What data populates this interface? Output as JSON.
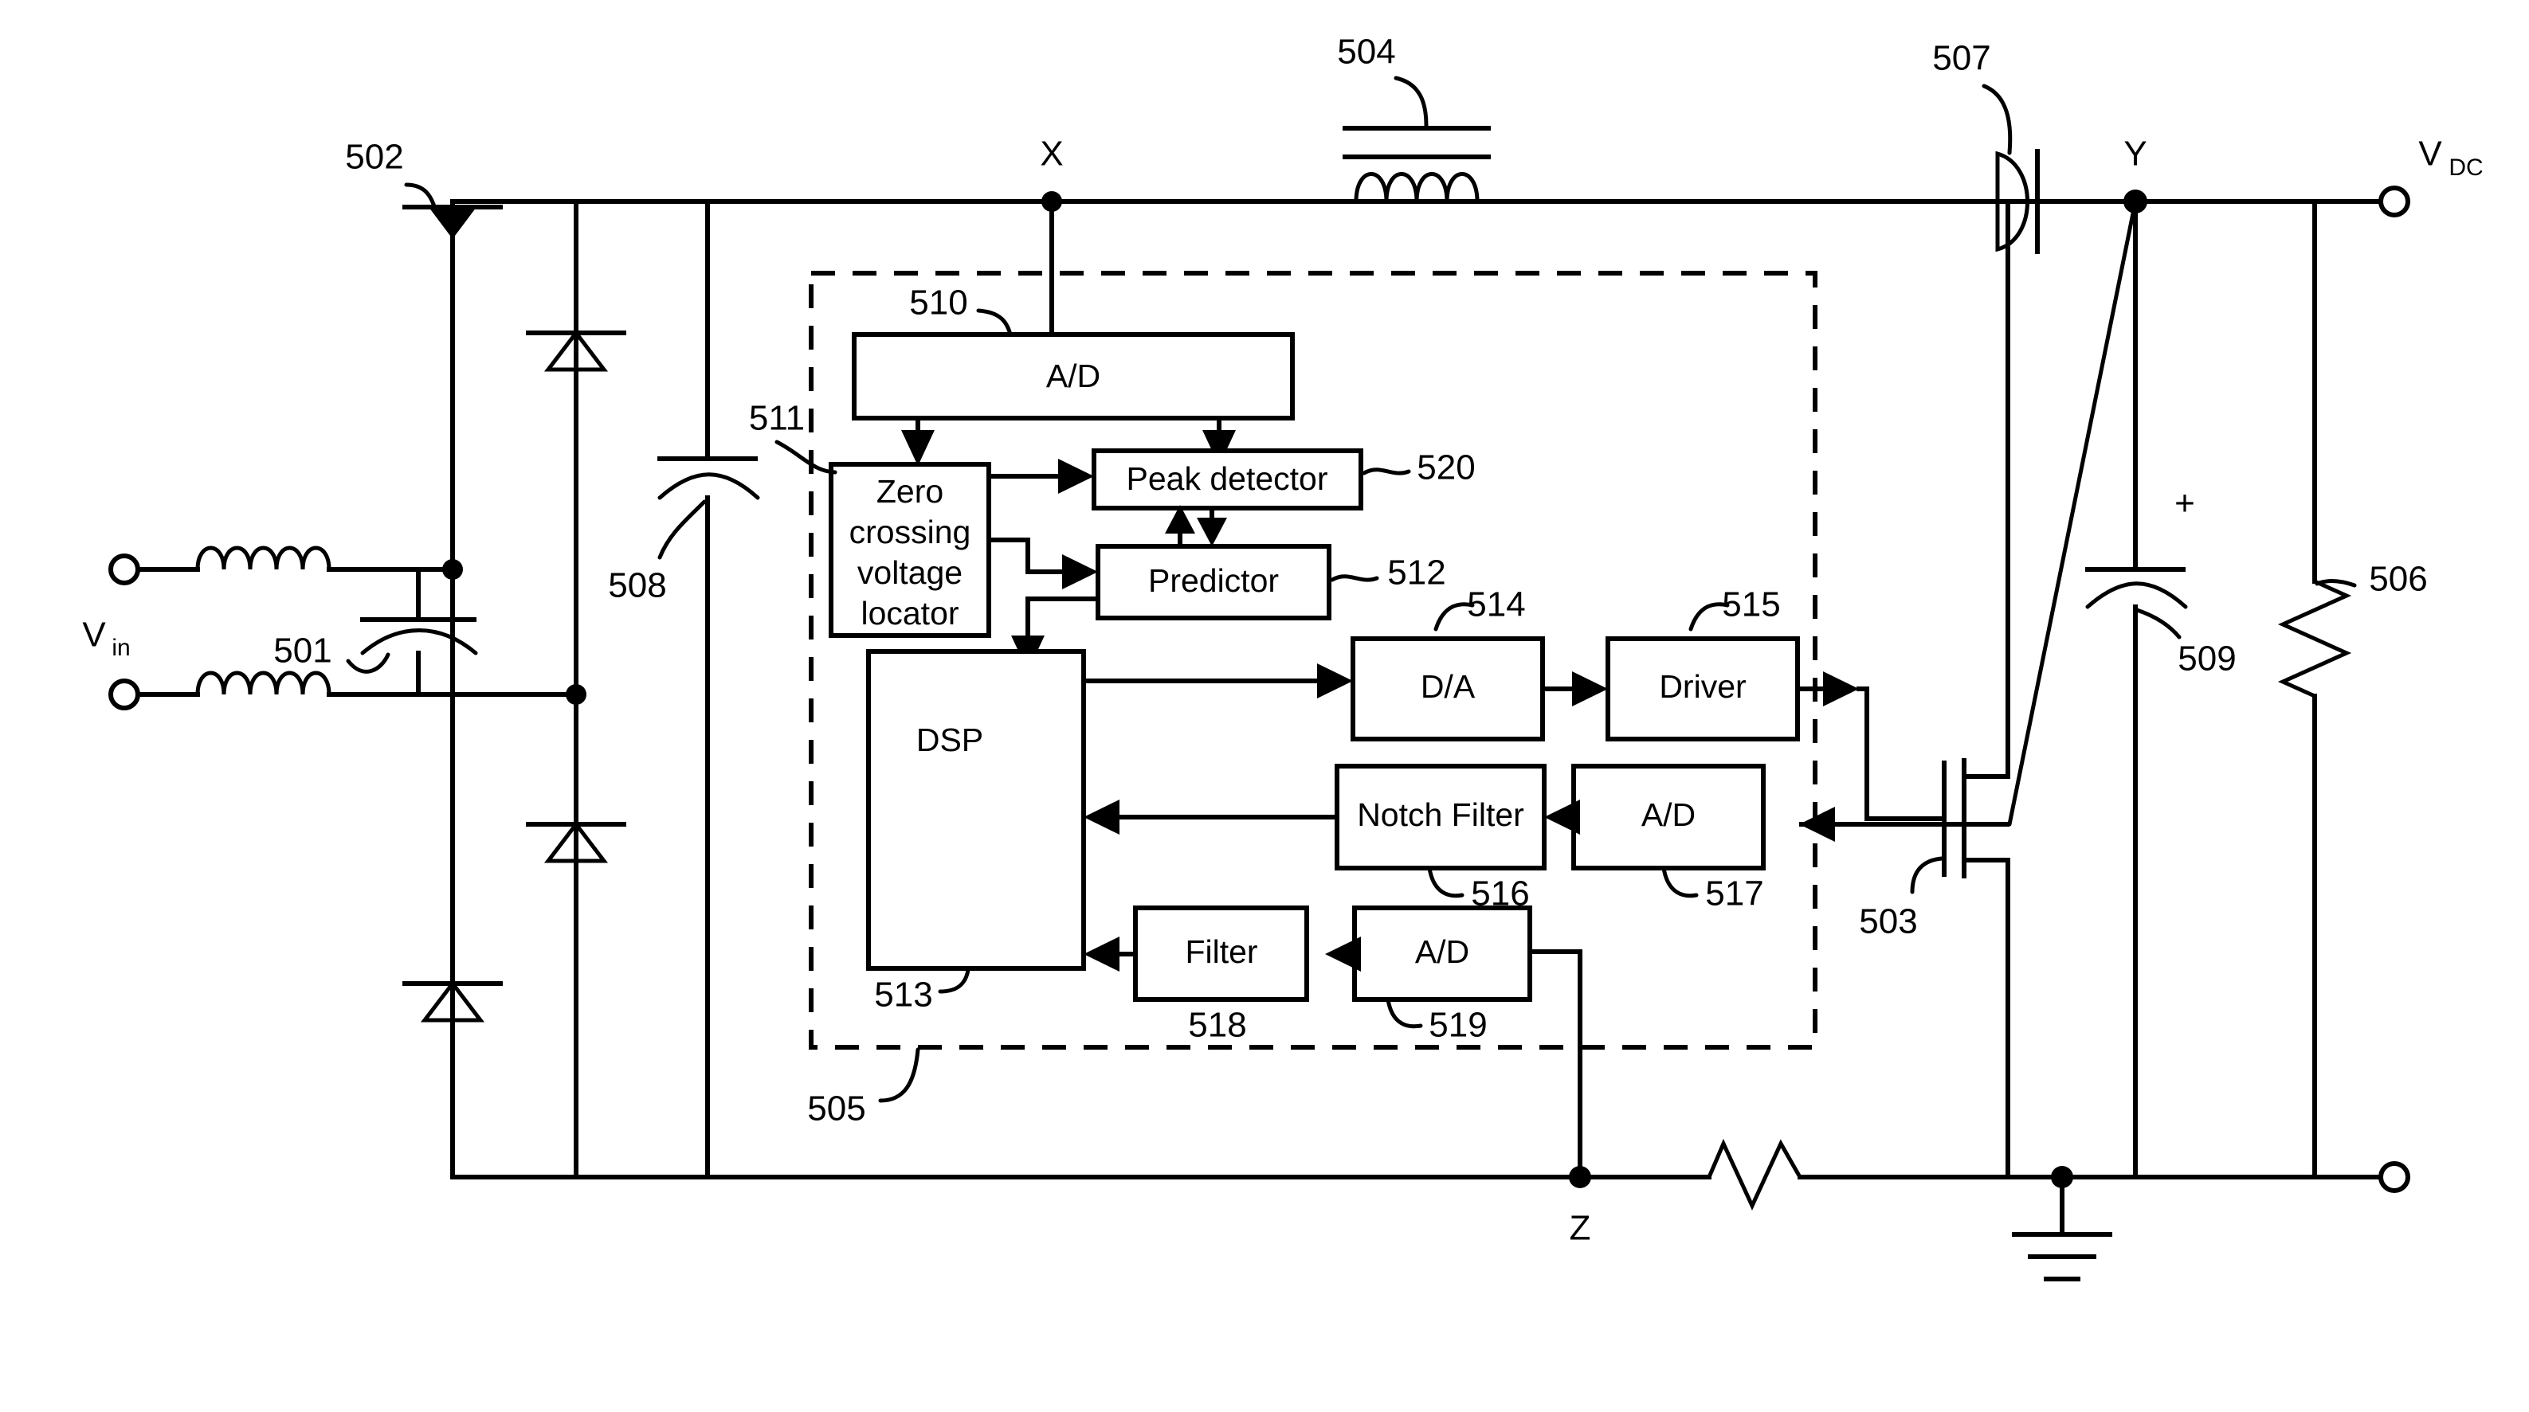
{
  "figure": {
    "type": "power-factor-correction-boost-converter-schematic",
    "background_color": "#ffffff",
    "line_color": "#000000"
  },
  "terminals": {
    "vin_label": "V",
    "vin_sub": "in",
    "vdc_label": "V",
    "vdc_sub": "DC"
  },
  "nodes": {
    "x": "X",
    "y": "Y",
    "z": "Z",
    "polarity_plus": "+"
  },
  "reference_numerals": {
    "emi_filter_cap": "501",
    "bridge_diode": "502",
    "mosfet": "503",
    "boost_inductor": "504",
    "controller_block": "505",
    "load_resistor": "506",
    "boost_diode": "507",
    "input_cap": "508",
    "output_cap": "509",
    "ad_input": "510",
    "zero_crossing_locator": "511",
    "predictor": "512",
    "dsp": "513",
    "da": "514",
    "driver": "515",
    "notch_filter": "516",
    "ad_current_sense": "517",
    "filter": "518",
    "ad_return_sense": "519",
    "peak_detector": "520"
  },
  "blocks": {
    "ad_top": "A/D",
    "zero_crossing": "Zero crossing voltage locator",
    "zero_crossing_lines": [
      "Zero",
      "crossing",
      "voltage",
      "locator"
    ],
    "peak_detector": "Peak detector",
    "predictor": "Predictor",
    "dsp": "DSP",
    "da": "D/A",
    "driver": "Driver",
    "notch_filter": "Notch Filter",
    "ad_mid": "A/D",
    "filter": "Filter",
    "ad_bottom": "A/D"
  },
  "components": [
    {
      "name": "input-inductor-top",
      "kind": "inductor"
    },
    {
      "name": "input-inductor-bottom",
      "kind": "inductor"
    },
    {
      "name": "emi-capacitor-501",
      "kind": "capacitor",
      "ref": "501"
    },
    {
      "name": "bridge-diode-502",
      "kind": "diode",
      "ref": "502"
    },
    {
      "name": "bridge-diode-upper-right",
      "kind": "diode"
    },
    {
      "name": "bridge-diode-lower-right",
      "kind": "diode"
    },
    {
      "name": "bridge-diode-lower-left",
      "kind": "diode"
    },
    {
      "name": "input-capacitor-508",
      "kind": "capacitor",
      "ref": "508"
    },
    {
      "name": "boost-inductor-504",
      "kind": "inductor-with-core",
      "ref": "504"
    },
    {
      "name": "boost-diode-507",
      "kind": "diode",
      "ref": "507"
    },
    {
      "name": "mosfet-503",
      "kind": "n-channel-mosfet",
      "ref": "503"
    },
    {
      "name": "output-capacitor-509",
      "kind": "polarized-capacitor",
      "ref": "509"
    },
    {
      "name": "load-resistor-506",
      "kind": "resistor",
      "ref": "506"
    },
    {
      "name": "sense-resistor",
      "kind": "resistor"
    },
    {
      "name": "ground",
      "kind": "earth-ground"
    }
  ]
}
